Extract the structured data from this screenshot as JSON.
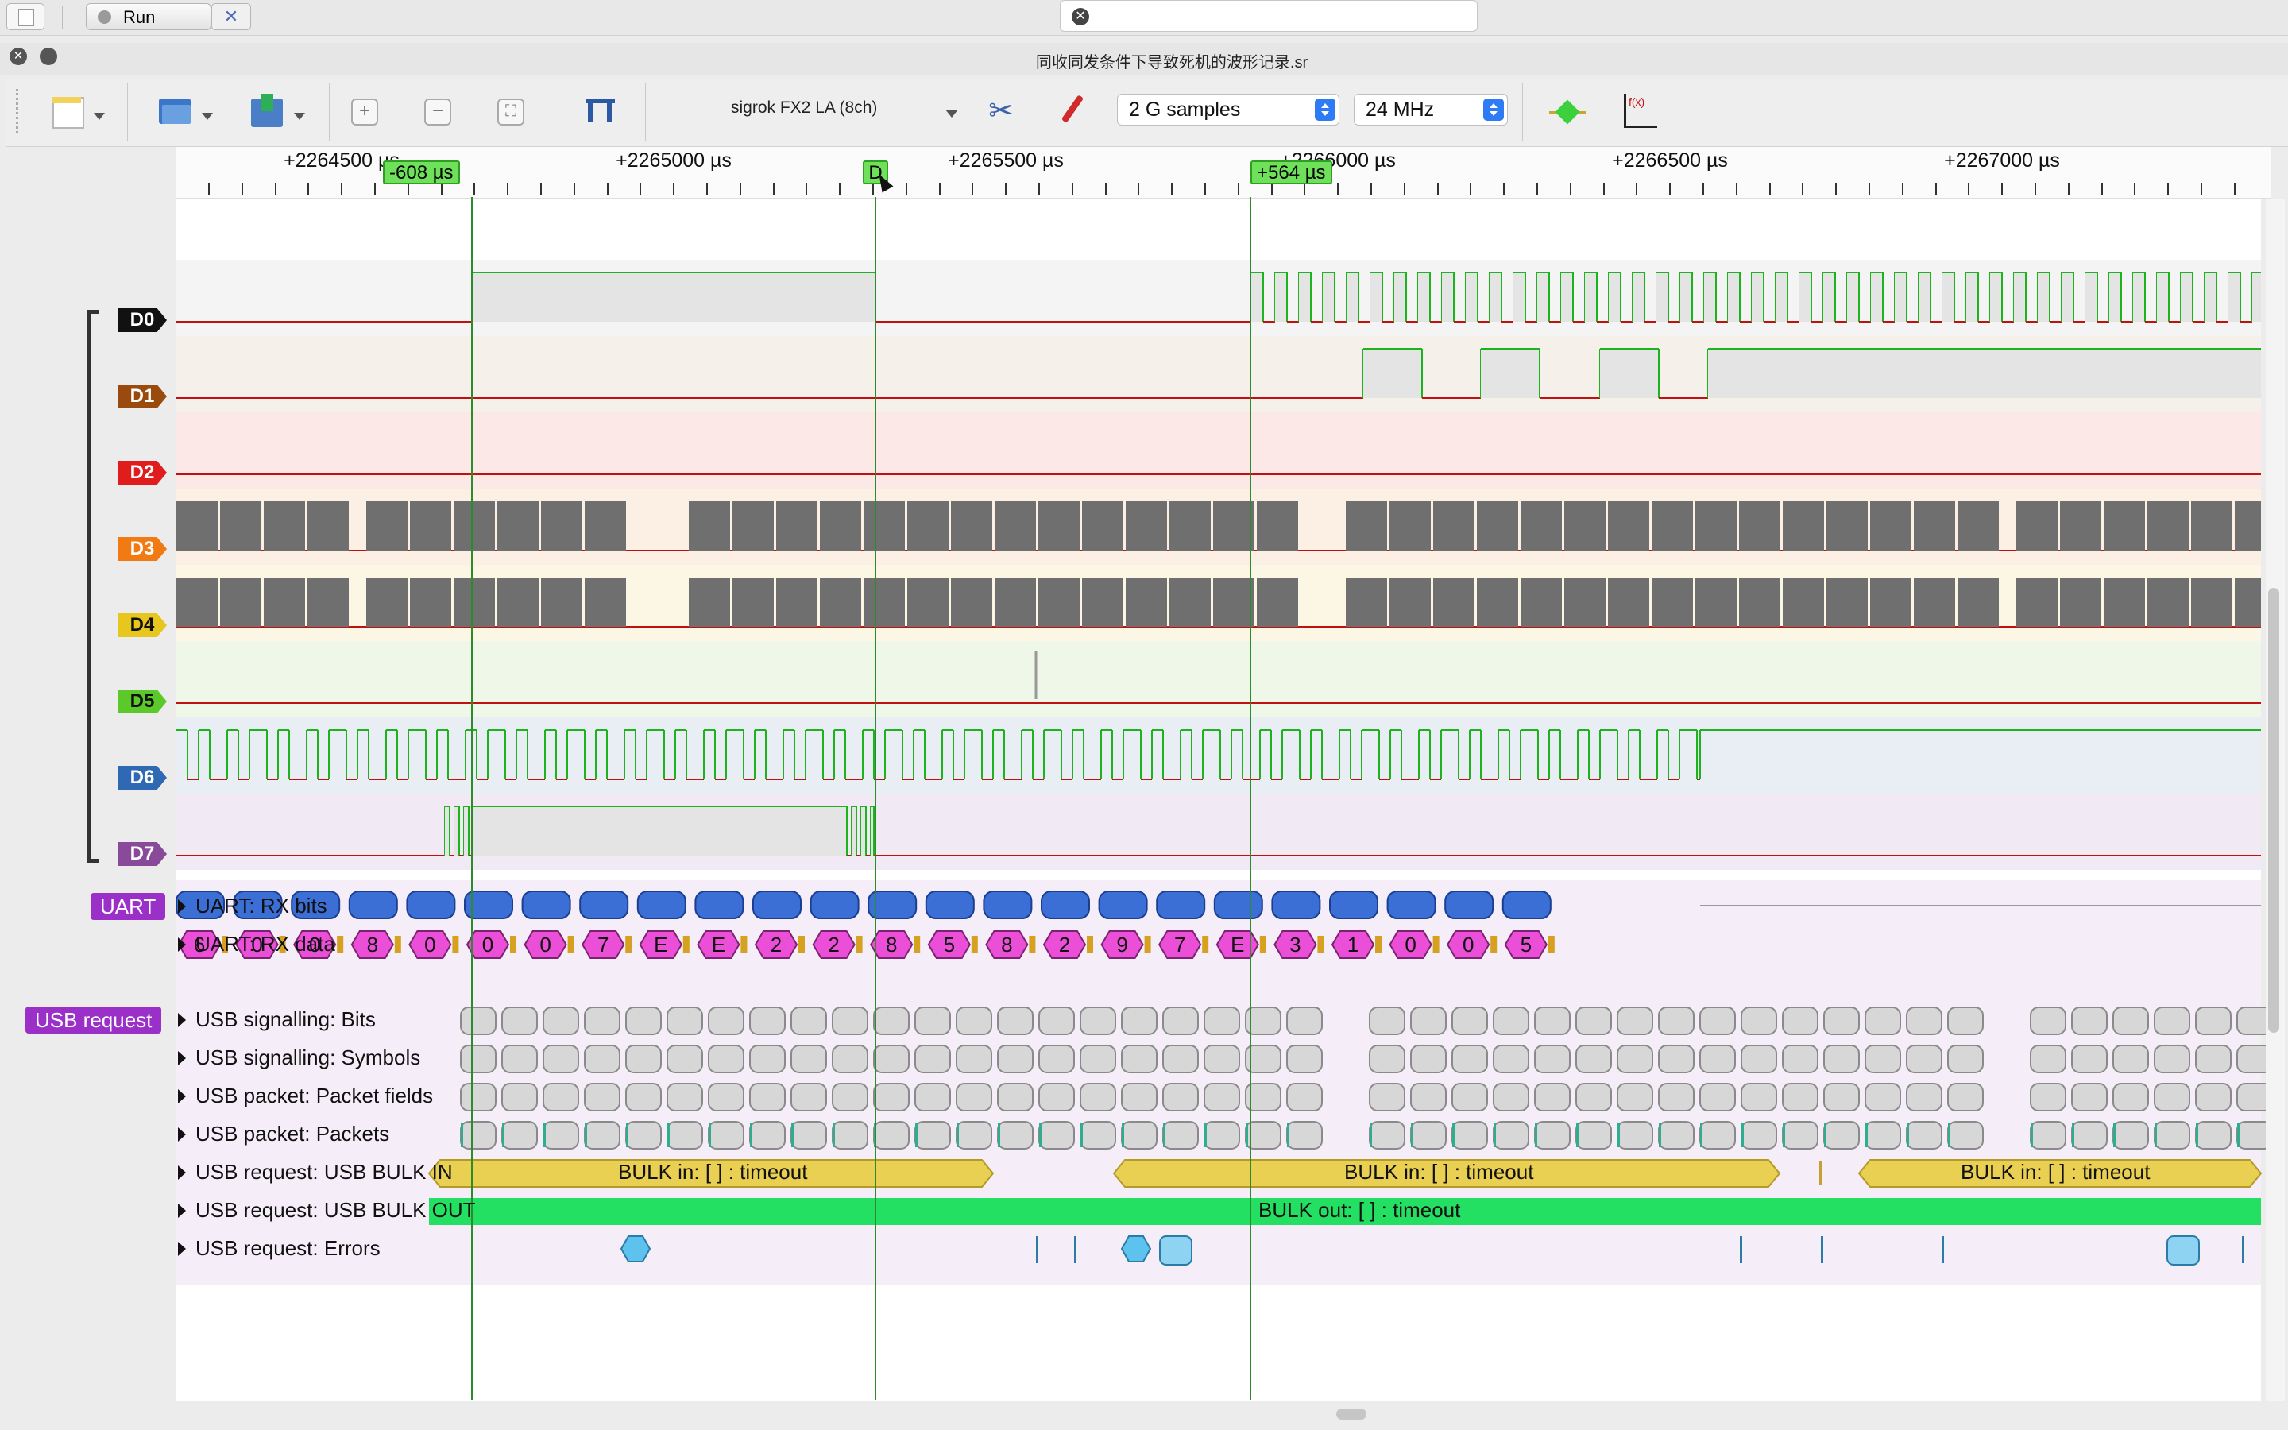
{
  "topbar": {
    "run_label": "Run"
  },
  "window": {
    "title": "同收同发条件下导致死机的波形记录.sr"
  },
  "toolbar": {
    "device": "sigrok FX2 LA (8ch)",
    "samples": "2 G samples",
    "samplerate": "24 MHz"
  },
  "ruler": {
    "labels": [
      "+2264500 µs",
      "+2265000 µs",
      "+2265500 µs",
      "+2266000 µs",
      "+2266500 µs",
      "+2267000 µs"
    ],
    "cursor_left": "-608 µs",
    "cursor_mid": "D",
    "cursor_right": "+564 µs"
  },
  "channels": [
    {
      "name": "D0",
      "color": "#111111"
    },
    {
      "name": "D1",
      "color": "#9a4a0c"
    },
    {
      "name": "D2",
      "color": "#e01c1c"
    },
    {
      "name": "D3",
      "color": "#f27a12"
    },
    {
      "name": "D4",
      "color": "#e7c61e"
    },
    {
      "name": "D5",
      "color": "#5cc92b"
    },
    {
      "name": "D6",
      "color": "#2f69b3"
    },
    {
      "name": "D7",
      "color": "#8a4a9a"
    }
  ],
  "groups": {
    "uart": {
      "label": "UART",
      "color": "#9a30c8"
    },
    "usb": {
      "label": "USB request",
      "color": "#9a30c8"
    }
  },
  "decoder_rows": {
    "uart_bits": "UART: RX bits",
    "uart_data": "UART: RX data",
    "usb_bits": "USB signalling: Bits",
    "usb_symbols": "USB signalling: Symbols",
    "usb_fields": "USB packet: Packet fields",
    "usb_packets": "USB packet: Packets",
    "usb_bulk_in": "USB request: USB BULK IN",
    "usb_bulk_out": "USB request: USB BULK OUT",
    "usb_errors": "USB request: Errors"
  },
  "uart_data_values": [
    "6",
    "0",
    "0",
    "8",
    "0",
    "0",
    "0",
    "7",
    "E",
    "E",
    "2",
    "2",
    "8",
    "5",
    "8",
    "2",
    "9",
    "7",
    "E",
    "3",
    "1",
    "0",
    "0",
    "5"
  ],
  "usb": {
    "bulk_in_text": "BULK in: [ ] : timeout",
    "bulk_out_text": "BULK out: [ ] : timeout"
  },
  "colors": {
    "trace_high": "#1db31d",
    "trace_low": "#c01010",
    "uart_bits": "#3b6fd6",
    "uart_data": "#ec4fd7",
    "bulk_in": "#e9cf52",
    "bulk_out": "#23e062",
    "error": "#5ec2ee",
    "cursor": "#2c8c2c"
  }
}
